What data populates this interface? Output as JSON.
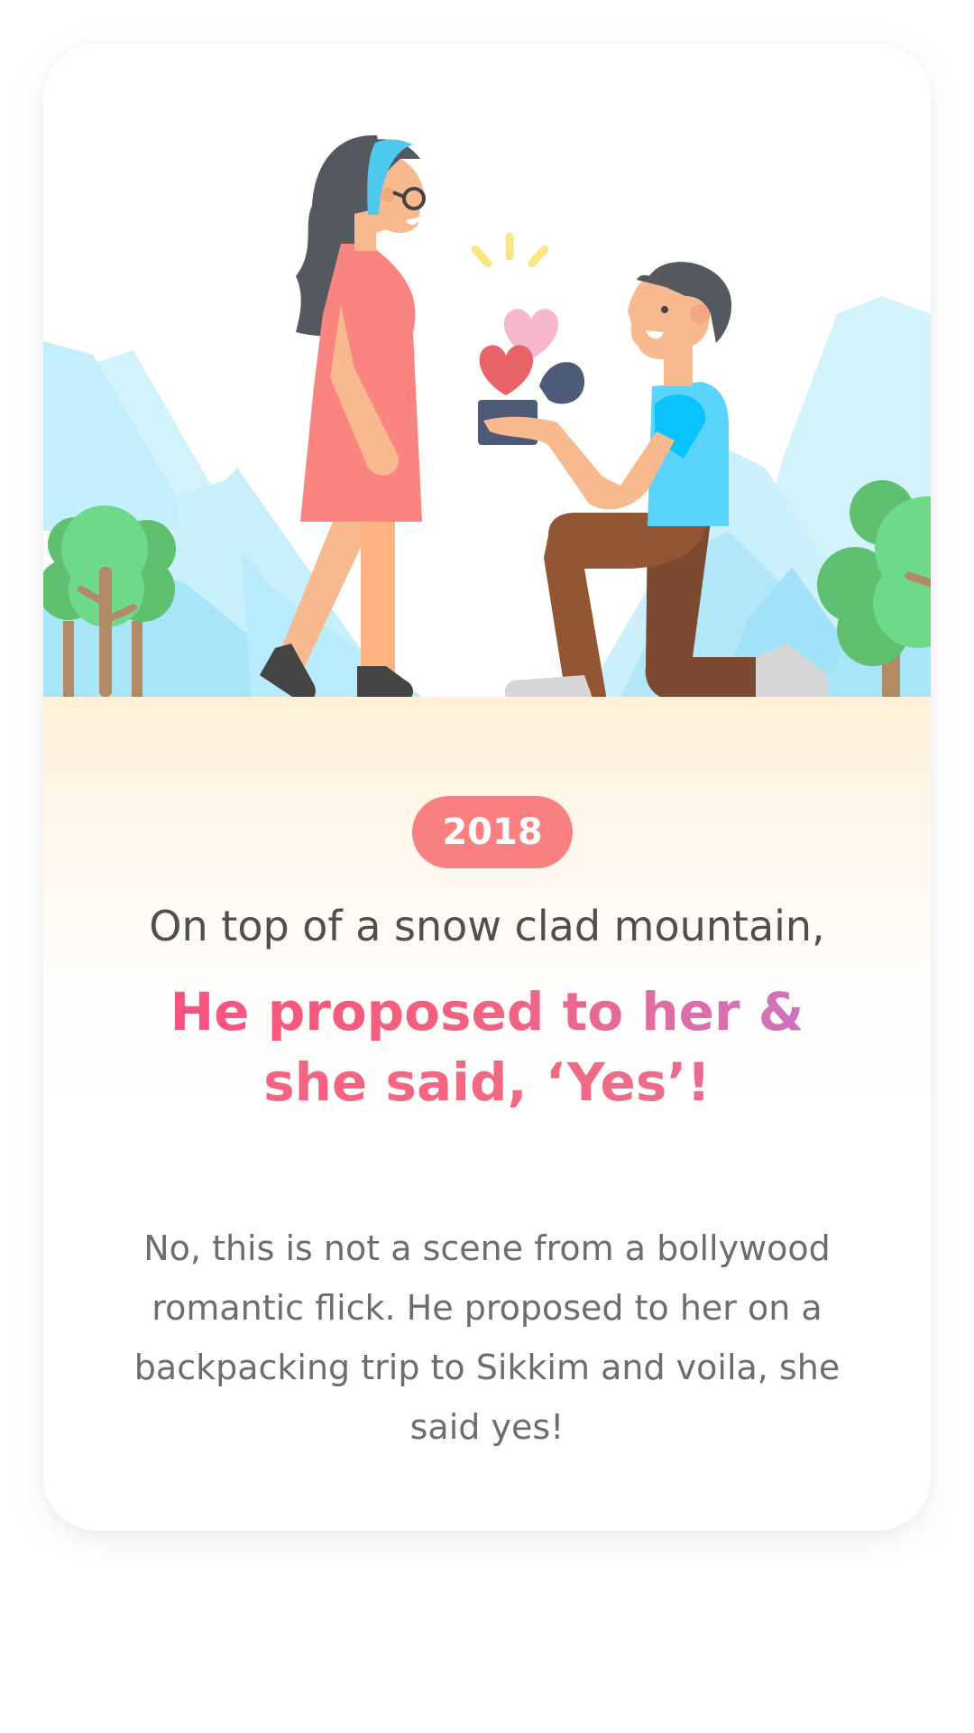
{
  "story": {
    "year": "2018",
    "lead": "On top of a snow clad mountain,",
    "headline_line1": "He proposed to her &",
    "headline_line2": "she said, ‘Yes’!",
    "body": "No, this is not a scene from a bollywood romantic flick. He proposed to her on a backpacking trip to Sikkim and voila, she said yes!"
  },
  "illustration": {
    "icons": [
      "mountains-illustration",
      "tree-icon",
      "woman-figure-icon",
      "kneeling-man-figure-icon",
      "ring-box-icon",
      "heart-icon",
      "sparkle-icon"
    ]
  },
  "colors": {
    "badge": "#fa7f80",
    "headline_start": "#fb4c80",
    "headline_end": "#a56be6",
    "ground": "#fff1d8",
    "sky_mountain": "#c9f0fc"
  }
}
